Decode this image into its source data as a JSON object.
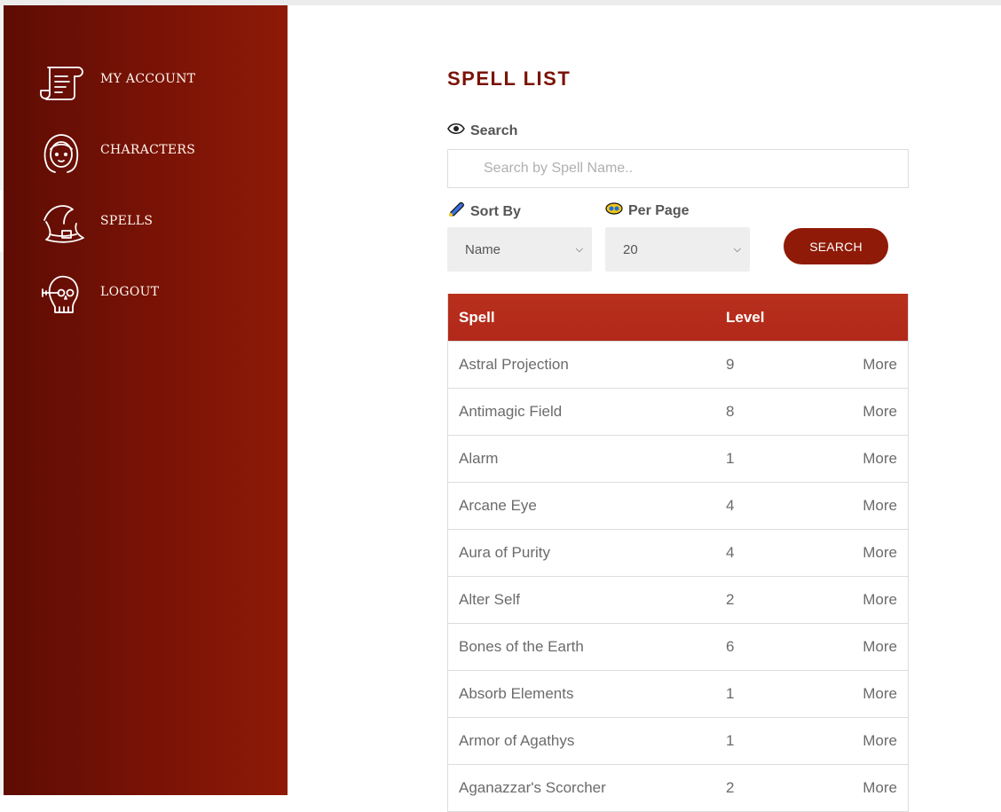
{
  "sidebar": {
    "items": [
      {
        "label": "MY ACCOUNT",
        "icon": "scroll-icon"
      },
      {
        "label": "CHARACTERS",
        "icon": "character-face-icon"
      },
      {
        "label": "SPELLS",
        "icon": "wizard-hat-icon"
      },
      {
        "label": "LOGOUT",
        "icon": "skull-key-icon"
      }
    ],
    "active": "SPELLS"
  },
  "main": {
    "title": "SPELL LIST",
    "search": {
      "label": "Search",
      "placeholder": "Search by Spell Name..",
      "value": ""
    },
    "sort": {
      "label": "Sort By",
      "selected": "Name"
    },
    "per_page": {
      "label": "Per Page",
      "selected": "20"
    },
    "search_button": "SEARCH",
    "table": {
      "headers": [
        "Spell",
        "Level"
      ],
      "rows": [
        {
          "spell": "Astral Projection",
          "level": "9",
          "action": "More"
        },
        {
          "spell": "Antimagic Field",
          "level": "8",
          "action": "More"
        },
        {
          "spell": "Alarm",
          "level": "1",
          "action": "More"
        },
        {
          "spell": "Arcane Eye",
          "level": "4",
          "action": "More"
        },
        {
          "spell": "Aura of Purity",
          "level": "4",
          "action": "More"
        },
        {
          "spell": "Alter Self",
          "level": "2",
          "action": "More"
        },
        {
          "spell": "Bones of the Earth",
          "level": "6",
          "action": "More"
        },
        {
          "spell": "Absorb Elements",
          "level": "1",
          "action": "More"
        },
        {
          "spell": "Armor of Agathys",
          "level": "1",
          "action": "More"
        },
        {
          "spell": "Aganazzar's Scorcher",
          "level": "2",
          "action": "More"
        }
      ]
    }
  },
  "colors": {
    "sidebar_dark": "#5e0c04",
    "sidebar_light": "#8e1a07",
    "accent": "#b8301c",
    "title": "#7a1306"
  }
}
